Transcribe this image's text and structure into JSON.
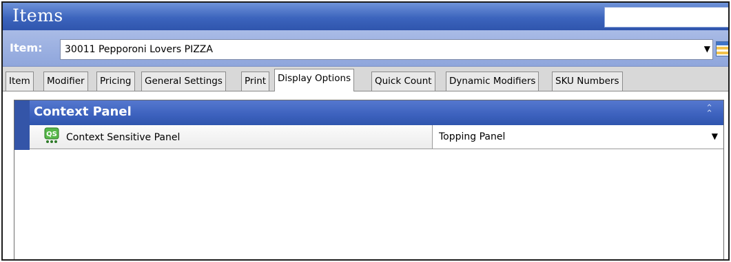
{
  "window": {
    "title": "Items"
  },
  "item_selector": {
    "label": "Item:",
    "value": "30011 Pepporoni Lovers PIZZA",
    "dropdown_arrow": "▼",
    "grid_icon": "table-grid-icon"
  },
  "tabs": [
    {
      "label": "Item"
    },
    {
      "label": "Modifier"
    },
    {
      "label": "Pricing"
    },
    {
      "label": "General Settings"
    },
    {
      "label": "Print"
    },
    {
      "label": "Display Options",
      "active": true
    },
    {
      "label": "Quick Count"
    },
    {
      "label": "Dynamic Modifiers"
    },
    {
      "label": "SKU Numbers"
    }
  ],
  "context_panel": {
    "title": "Context Panel",
    "collapse_icon": "double-chevron-up-icon",
    "rows": [
      {
        "icon": "qs-icon",
        "icon_text": "QS",
        "label": "Context Sensitive Panel",
        "value": "Topping Panel",
        "dropdown_arrow": "▼"
      }
    ]
  },
  "colors": {
    "title_bar": "#3c64bd",
    "item_bar": "#9bb0e0",
    "panel_header": "#3c61bd"
  }
}
